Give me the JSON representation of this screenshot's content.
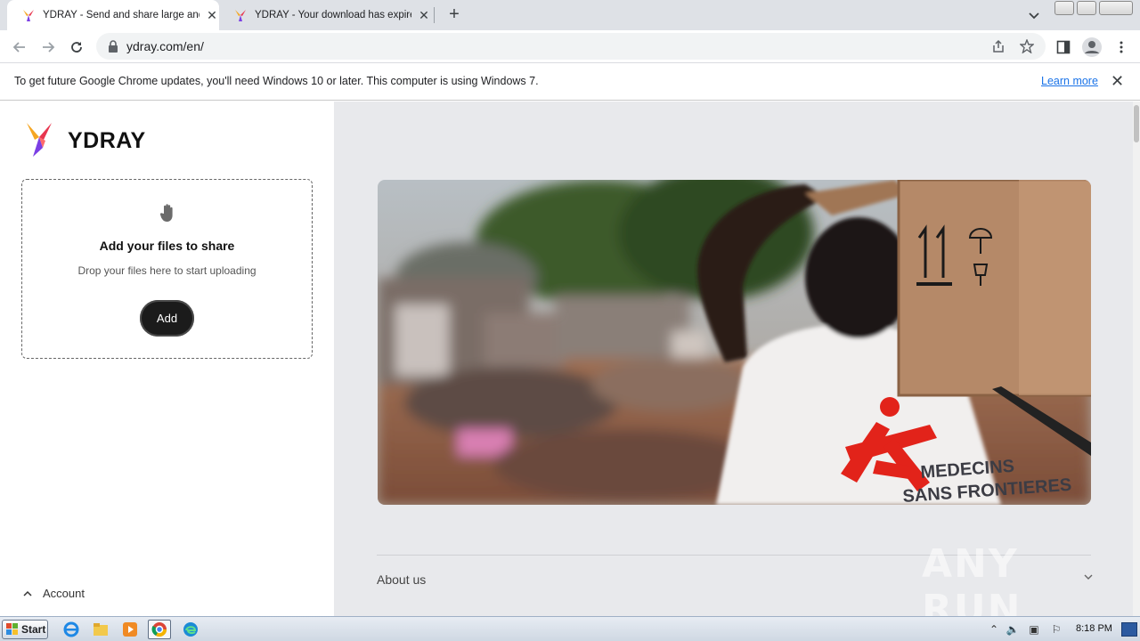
{
  "browser": {
    "tabs": [
      {
        "title": "YDRAY - Send and share large and b",
        "active": true
      },
      {
        "title": "YDRAY - Your download has expired",
        "active": false
      }
    ],
    "url": "ydray.com/en/"
  },
  "infobar": {
    "message": "To get future Google Chrome updates, you'll need Windows 10 or later. This computer is using Windows 7.",
    "link": "Learn more"
  },
  "page": {
    "brand": "YDRAY",
    "upload": {
      "heading": "Add your files to share",
      "subtext": "Drop your files here to start uploading",
      "button": "Add"
    },
    "account_label": "Account",
    "hero_text": [
      "MEDECINS",
      "SANS FRONTIERES"
    ],
    "footer": {
      "about": "About us"
    }
  },
  "watermark": "ANY RUN",
  "taskbar": {
    "start": "Start",
    "clock": "8:18 PM"
  },
  "colors": {
    "accent_link": "#1a73e8",
    "msf_red": "#e2231a",
    "page_bg": "#e8e9ec"
  }
}
